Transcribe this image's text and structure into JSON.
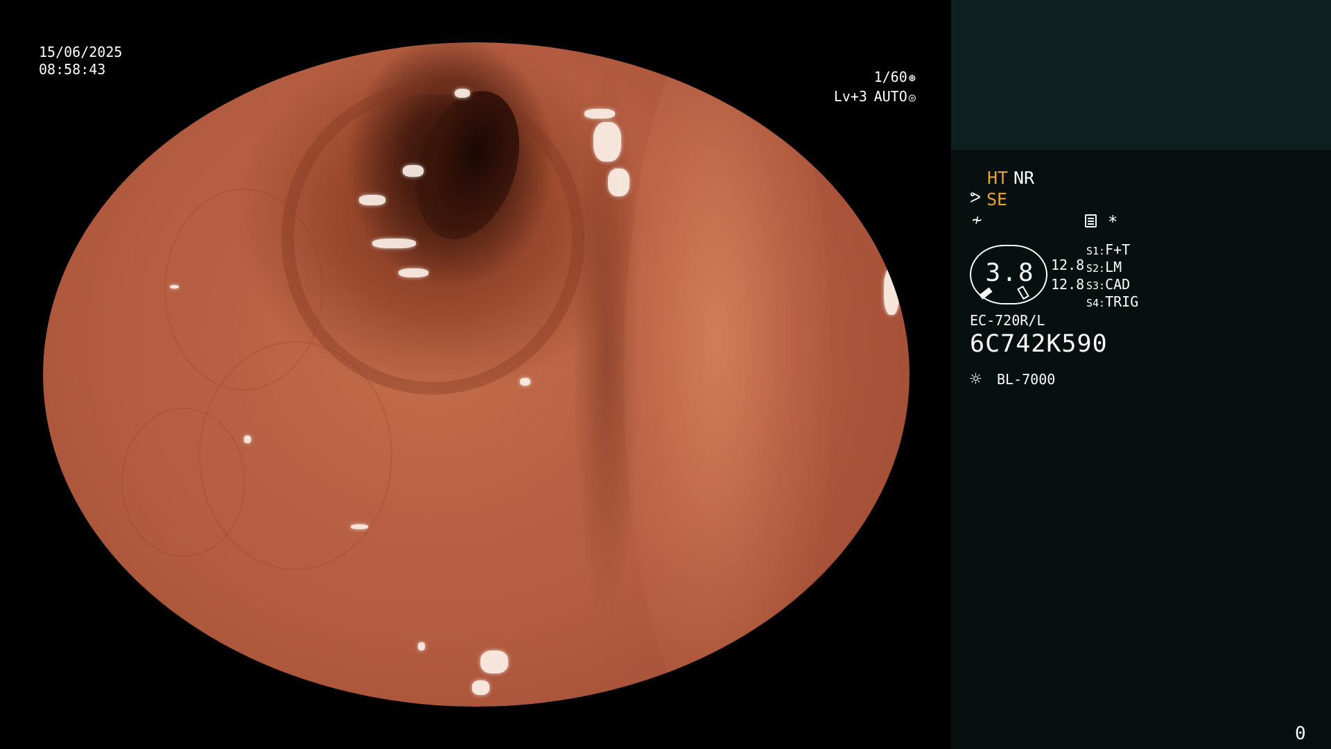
{
  "overlay": {
    "date": "15/06/2025",
    "time": "08:58:43",
    "shutter": "1/60",
    "shutter_icon": "aperture-icon",
    "level": "Lv+3",
    "exposure_mode": "AUTO",
    "exposure_icon": "iris-icon"
  },
  "panel": {
    "ht_label": "HT",
    "nr_label": "NR",
    "se_label": "SE",
    "se_icon": "wave-icon",
    "flash_icon": "no-flash-icon",
    "memo_icon": "memo-icon",
    "star_label": "*",
    "zoom_value": "3.8",
    "zoom_row1": "12.8",
    "zoom_row2": "12.8",
    "slots": [
      {
        "key": "S1:",
        "value": "F+T"
      },
      {
        "key": "S2:",
        "value": "LM"
      },
      {
        "key": "S3:",
        "value": "CAD"
      },
      {
        "key": "S4:",
        "value": "TRIG"
      }
    ],
    "scope_model": "EC-720R/L",
    "scope_serial": "6C742K590",
    "light_icon": "sun-icon",
    "light_source": "BL-7000",
    "counter": "0",
    "accent_color": "#e9a22b"
  }
}
